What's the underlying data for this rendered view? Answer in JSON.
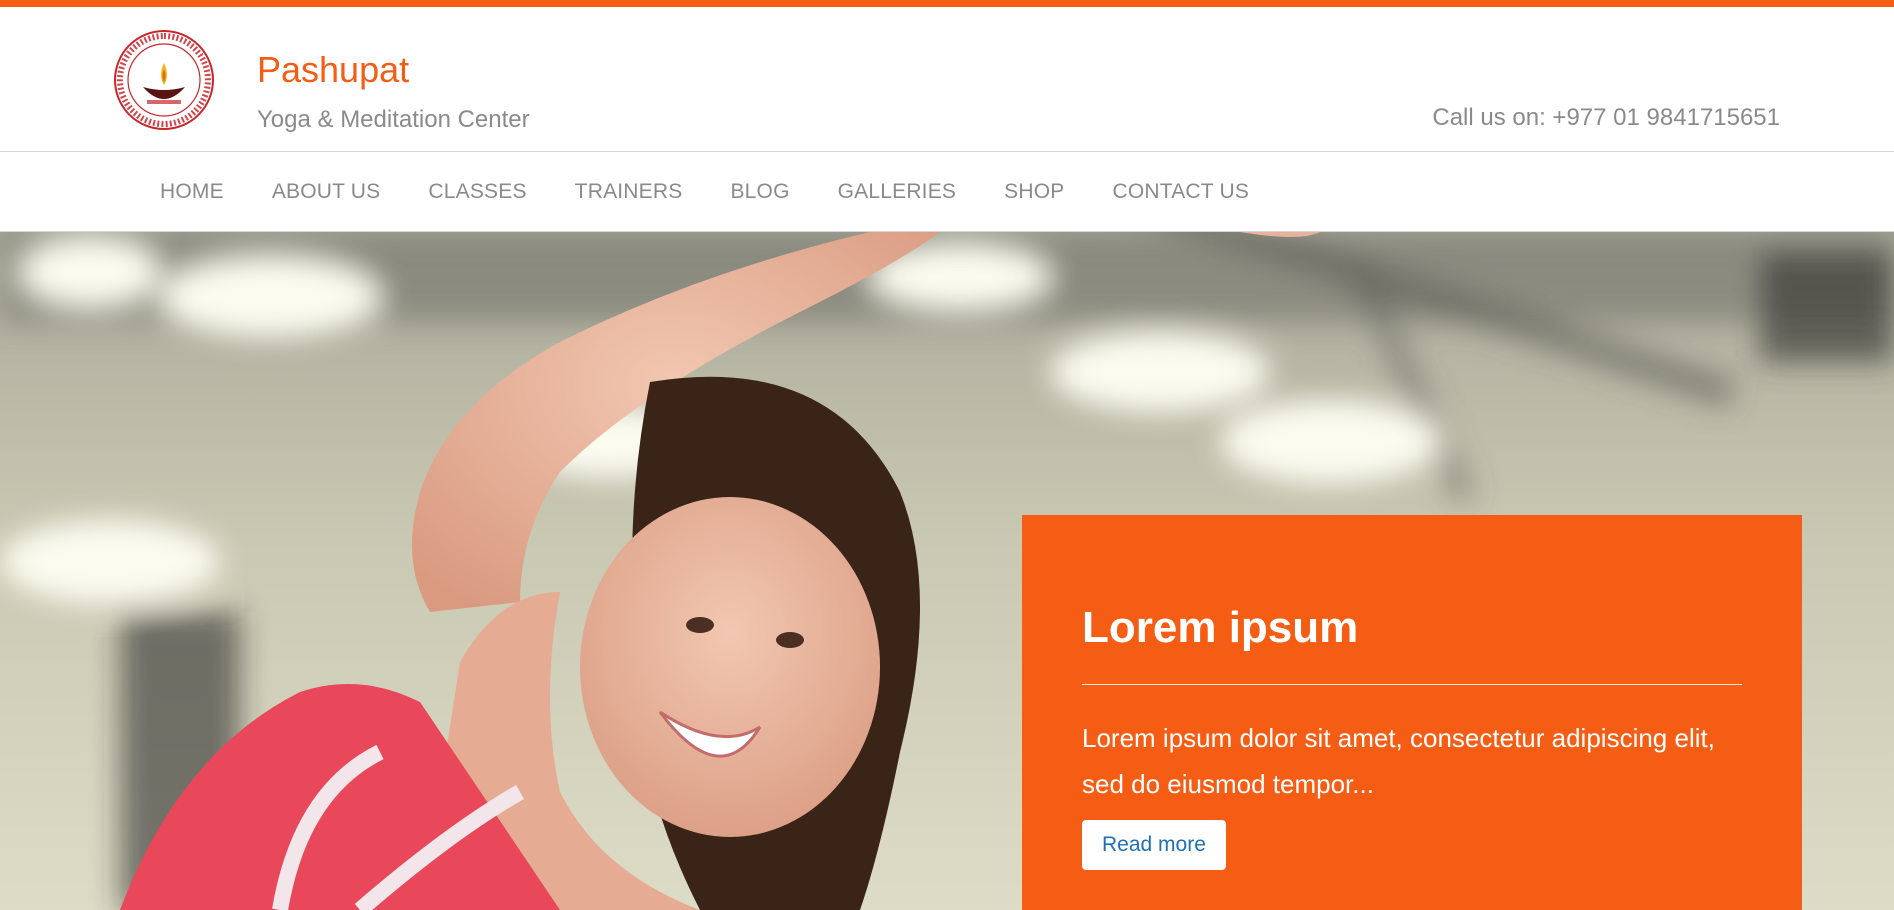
{
  "colors": {
    "accent": "#f55d14",
    "muted_text": "#8a8a8a",
    "link": "#1f6fb5"
  },
  "header": {
    "logo_icon": "diya-lamp-seal-icon",
    "logo_seal_text": "PASHUPAT YOGA AND MEDITATION CENTER",
    "title": "Pashupat",
    "tagline": "Yoga & Meditation Center",
    "phone": "Call us on: +977 01 9841715651"
  },
  "nav": {
    "items": [
      {
        "label": "HOME"
      },
      {
        "label": "ABOUT US"
      },
      {
        "label": "CLASSES"
      },
      {
        "label": "TRAINERS"
      },
      {
        "label": "BLOG"
      },
      {
        "label": "GALLERIES"
      },
      {
        "label": "SHOP"
      },
      {
        "label": "CONTACT US"
      }
    ]
  },
  "hero": {
    "image": "woman-stretching-in-gym-photo",
    "caption": {
      "title": "Lorem ipsum",
      "text": "Lorem ipsum dolor sit amet, consectetur adipiscing elit, sed do eiusmod tempor...",
      "button_label": "Read more"
    }
  }
}
